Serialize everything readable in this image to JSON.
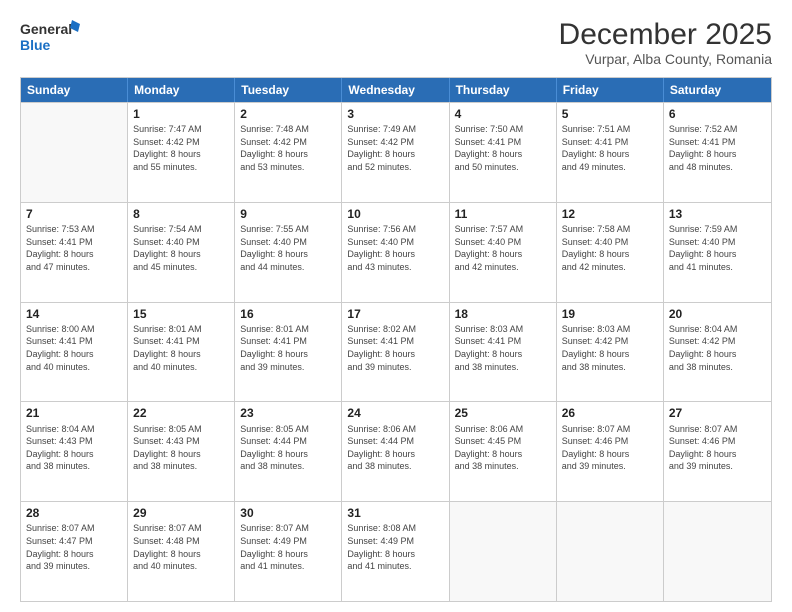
{
  "logo": {
    "line1": "General",
    "line2": "Blue"
  },
  "title": "December 2025",
  "subtitle": "Vurpar, Alba County, Romania",
  "header_days": [
    "Sunday",
    "Monday",
    "Tuesday",
    "Wednesday",
    "Thursday",
    "Friday",
    "Saturday"
  ],
  "weeks": [
    [
      {
        "day": "",
        "sunrise": "",
        "sunset": "",
        "daylight": ""
      },
      {
        "day": "1",
        "sunrise": "Sunrise: 7:47 AM",
        "sunset": "Sunset: 4:42 PM",
        "daylight": "Daylight: 8 hours and 55 minutes."
      },
      {
        "day": "2",
        "sunrise": "Sunrise: 7:48 AM",
        "sunset": "Sunset: 4:42 PM",
        "daylight": "Daylight: 8 hours and 53 minutes."
      },
      {
        "day": "3",
        "sunrise": "Sunrise: 7:49 AM",
        "sunset": "Sunset: 4:42 PM",
        "daylight": "Daylight: 8 hours and 52 minutes."
      },
      {
        "day": "4",
        "sunrise": "Sunrise: 7:50 AM",
        "sunset": "Sunset: 4:41 PM",
        "daylight": "Daylight: 8 hours and 50 minutes."
      },
      {
        "day": "5",
        "sunrise": "Sunrise: 7:51 AM",
        "sunset": "Sunset: 4:41 PM",
        "daylight": "Daylight: 8 hours and 49 minutes."
      },
      {
        "day": "6",
        "sunrise": "Sunrise: 7:52 AM",
        "sunset": "Sunset: 4:41 PM",
        "daylight": "Daylight: 8 hours and 48 minutes."
      }
    ],
    [
      {
        "day": "7",
        "sunrise": "Sunrise: 7:53 AM",
        "sunset": "Sunset: 4:41 PM",
        "daylight": "Daylight: 8 hours and 47 minutes."
      },
      {
        "day": "8",
        "sunrise": "Sunrise: 7:54 AM",
        "sunset": "Sunset: 4:40 PM",
        "daylight": "Daylight: 8 hours and 45 minutes."
      },
      {
        "day": "9",
        "sunrise": "Sunrise: 7:55 AM",
        "sunset": "Sunset: 4:40 PM",
        "daylight": "Daylight: 8 hours and 44 minutes."
      },
      {
        "day": "10",
        "sunrise": "Sunrise: 7:56 AM",
        "sunset": "Sunset: 4:40 PM",
        "daylight": "Daylight: 8 hours and 43 minutes."
      },
      {
        "day": "11",
        "sunrise": "Sunrise: 7:57 AM",
        "sunset": "Sunset: 4:40 PM",
        "daylight": "Daylight: 8 hours and 42 minutes."
      },
      {
        "day": "12",
        "sunrise": "Sunrise: 7:58 AM",
        "sunset": "Sunset: 4:40 PM",
        "daylight": "Daylight: 8 hours and 42 minutes."
      },
      {
        "day": "13",
        "sunrise": "Sunrise: 7:59 AM",
        "sunset": "Sunset: 4:40 PM",
        "daylight": "Daylight: 8 hours and 41 minutes."
      }
    ],
    [
      {
        "day": "14",
        "sunrise": "Sunrise: 8:00 AM",
        "sunset": "Sunset: 4:41 PM",
        "daylight": "Daylight: 8 hours and 40 minutes."
      },
      {
        "day": "15",
        "sunrise": "Sunrise: 8:01 AM",
        "sunset": "Sunset: 4:41 PM",
        "daylight": "Daylight: 8 hours and 40 minutes."
      },
      {
        "day": "16",
        "sunrise": "Sunrise: 8:01 AM",
        "sunset": "Sunset: 4:41 PM",
        "daylight": "Daylight: 8 hours and 39 minutes."
      },
      {
        "day": "17",
        "sunrise": "Sunrise: 8:02 AM",
        "sunset": "Sunset: 4:41 PM",
        "daylight": "Daylight: 8 hours and 39 minutes."
      },
      {
        "day": "18",
        "sunrise": "Sunrise: 8:03 AM",
        "sunset": "Sunset: 4:41 PM",
        "daylight": "Daylight: 8 hours and 38 minutes."
      },
      {
        "day": "19",
        "sunrise": "Sunrise: 8:03 AM",
        "sunset": "Sunset: 4:42 PM",
        "daylight": "Daylight: 8 hours and 38 minutes."
      },
      {
        "day": "20",
        "sunrise": "Sunrise: 8:04 AM",
        "sunset": "Sunset: 4:42 PM",
        "daylight": "Daylight: 8 hours and 38 minutes."
      }
    ],
    [
      {
        "day": "21",
        "sunrise": "Sunrise: 8:04 AM",
        "sunset": "Sunset: 4:43 PM",
        "daylight": "Daylight: 8 hours and 38 minutes."
      },
      {
        "day": "22",
        "sunrise": "Sunrise: 8:05 AM",
        "sunset": "Sunset: 4:43 PM",
        "daylight": "Daylight: 8 hours and 38 minutes."
      },
      {
        "day": "23",
        "sunrise": "Sunrise: 8:05 AM",
        "sunset": "Sunset: 4:44 PM",
        "daylight": "Daylight: 8 hours and 38 minutes."
      },
      {
        "day": "24",
        "sunrise": "Sunrise: 8:06 AM",
        "sunset": "Sunset: 4:44 PM",
        "daylight": "Daylight: 8 hours and 38 minutes."
      },
      {
        "day": "25",
        "sunrise": "Sunrise: 8:06 AM",
        "sunset": "Sunset: 4:45 PM",
        "daylight": "Daylight: 8 hours and 38 minutes."
      },
      {
        "day": "26",
        "sunrise": "Sunrise: 8:07 AM",
        "sunset": "Sunset: 4:46 PM",
        "daylight": "Daylight: 8 hours and 39 minutes."
      },
      {
        "day": "27",
        "sunrise": "Sunrise: 8:07 AM",
        "sunset": "Sunset: 4:46 PM",
        "daylight": "Daylight: 8 hours and 39 minutes."
      }
    ],
    [
      {
        "day": "28",
        "sunrise": "Sunrise: 8:07 AM",
        "sunset": "Sunset: 4:47 PM",
        "daylight": "Daylight: 8 hours and 39 minutes."
      },
      {
        "day": "29",
        "sunrise": "Sunrise: 8:07 AM",
        "sunset": "Sunset: 4:48 PM",
        "daylight": "Daylight: 8 hours and 40 minutes."
      },
      {
        "day": "30",
        "sunrise": "Sunrise: 8:07 AM",
        "sunset": "Sunset: 4:49 PM",
        "daylight": "Daylight: 8 hours and 41 minutes."
      },
      {
        "day": "31",
        "sunrise": "Sunrise: 8:08 AM",
        "sunset": "Sunset: 4:49 PM",
        "daylight": "Daylight: 8 hours and 41 minutes."
      },
      {
        "day": "",
        "sunrise": "",
        "sunset": "",
        "daylight": ""
      },
      {
        "day": "",
        "sunrise": "",
        "sunset": "",
        "daylight": ""
      },
      {
        "day": "",
        "sunrise": "",
        "sunset": "",
        "daylight": ""
      }
    ]
  ]
}
